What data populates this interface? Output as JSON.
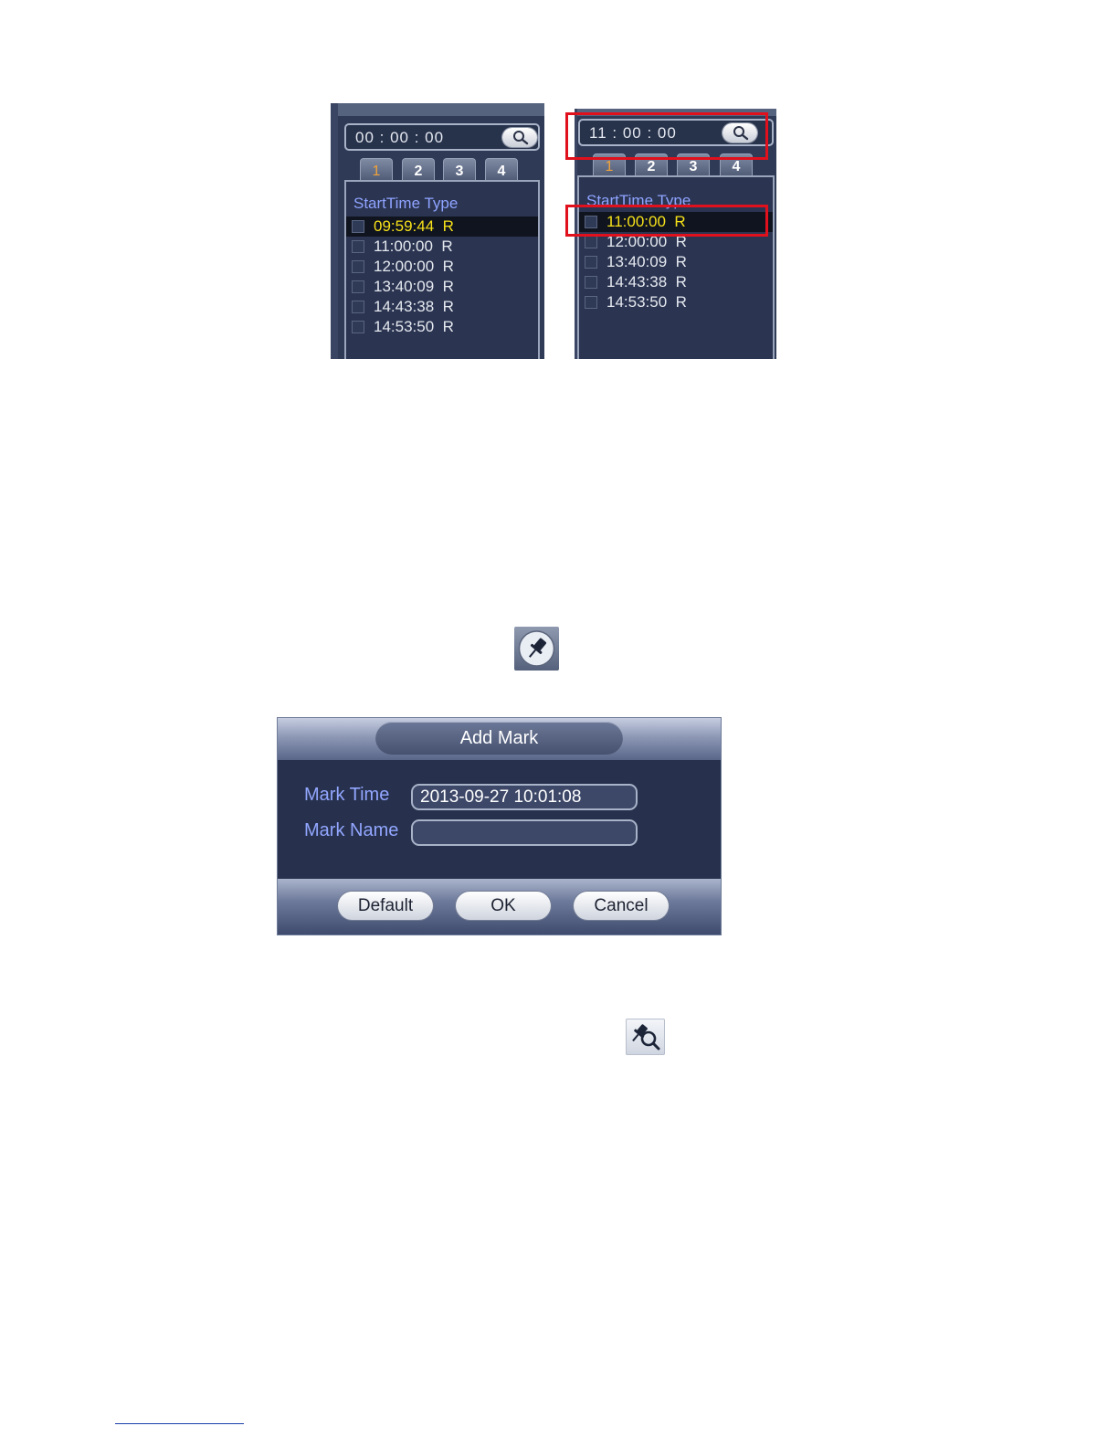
{
  "left_panel": {
    "time_value": "00 : 00 : 00",
    "tabs": [
      "1",
      "2",
      "3",
      "4"
    ],
    "active_tab": "1",
    "header": "StartTime Type",
    "rows": [
      {
        "text": "09:59:44  R",
        "selected": true
      },
      {
        "text": "11:00:00  R",
        "selected": false
      },
      {
        "text": "12:00:00  R",
        "selected": false
      },
      {
        "text": "13:40:09  R",
        "selected": false
      },
      {
        "text": "14:43:38  R",
        "selected": false
      },
      {
        "text": "14:53:50  R",
        "selected": false
      }
    ]
  },
  "right_panel": {
    "time_value": "11 : 00 : 00",
    "tabs": [
      "1",
      "2",
      "3",
      "4"
    ],
    "active_tab": "1",
    "header": "StartTime Type",
    "rows": [
      {
        "text": "11:00:00  R",
        "selected": true
      },
      {
        "text": "12:00:00  R",
        "selected": false
      },
      {
        "text": "13:40:09  R",
        "selected": false
      },
      {
        "text": "14:43:38  R",
        "selected": false
      },
      {
        "text": "14:53:50  R",
        "selected": false
      }
    ]
  },
  "icons": {
    "mark_icon": "pushpin-icon",
    "mark_search_icon": "pushpin-search-icon"
  },
  "dialog": {
    "title": "Add Mark",
    "mark_time_label": "Mark Time",
    "mark_time_value": "2013-09-27 10:01:08",
    "mark_name_label": "Mark Name",
    "mark_name_value": "",
    "buttons": {
      "default": "Default",
      "ok": "OK",
      "cancel": "Cancel"
    }
  },
  "colors": {
    "highlight_red": "#e0101c",
    "selected_text": "#f6e11a",
    "label_blue": "#92a6ff"
  }
}
